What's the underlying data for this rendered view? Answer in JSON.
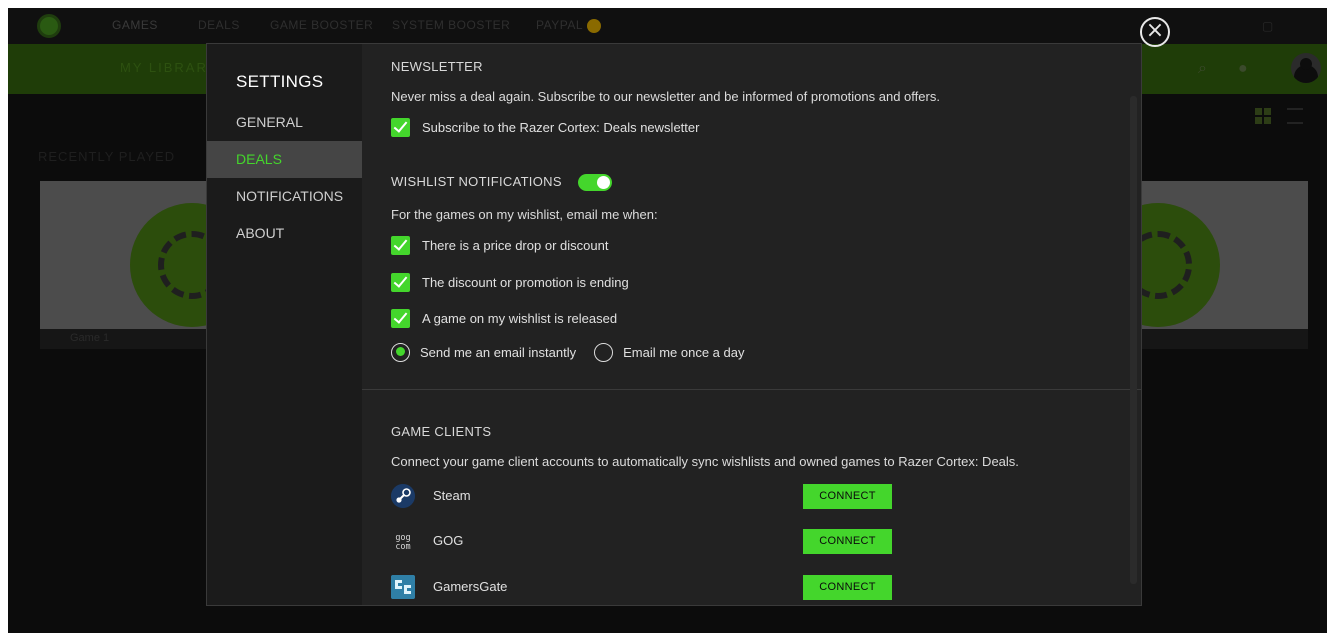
{
  "background_app": {
    "nav_tabs": [
      "GAMES",
      "DEALS",
      "GAME BOOSTER",
      "SYSTEM BOOSTER",
      "PAYPAL"
    ],
    "greenbar_text": "MY LIBRARY",
    "section_label": "RECENTLY PLAYED",
    "game_label": "Game 1"
  },
  "close_button": {
    "glyph": "×"
  },
  "settings": {
    "title": "SETTINGS",
    "nav": [
      {
        "label": "GENERAL",
        "active": false
      },
      {
        "label": "DEALS",
        "active": true
      },
      {
        "label": "NOTIFICATIONS",
        "active": false
      },
      {
        "label": "ABOUT",
        "active": false
      }
    ]
  },
  "newsletter": {
    "heading": "NEWSLETTER",
    "description": "Never miss a deal again. Subscribe to our newsletter and be informed of promotions and offers.",
    "subscribe_label": "Subscribe to the Razer Cortex: Deals newsletter",
    "subscribe_checked": true
  },
  "wishlist": {
    "heading": "WISHLIST NOTIFICATIONS",
    "toggle_on": true,
    "description": "For the games on my wishlist, email me when:",
    "options": [
      {
        "label": "There is a price drop or discount",
        "checked": true
      },
      {
        "label": "The discount or promotion is ending",
        "checked": true
      },
      {
        "label": "A game on my wishlist is released",
        "checked": true
      }
    ],
    "frequency": [
      {
        "label": "Send me an email instantly",
        "selected": true
      },
      {
        "label": "Email me once a day",
        "selected": false
      }
    ]
  },
  "game_clients": {
    "heading": "GAME CLIENTS",
    "description": "Connect your game client accounts to automatically sync wishlists and owned games to Razer Cortex: Deals.",
    "clients": [
      {
        "name": "Steam",
        "icon": "steam-icon",
        "button": "CONNECT"
      },
      {
        "name": "GOG",
        "icon": "gog-icon",
        "button": "CONNECT"
      },
      {
        "name": "GamersGate",
        "icon": "gamersgate-icon",
        "button": "CONNECT"
      }
    ]
  },
  "colors": {
    "accent": "#44d62c",
    "dialog_bg": "#222222",
    "sidebar_bg": "#1b1b1b",
    "sidebar_active_bg": "#454545"
  }
}
